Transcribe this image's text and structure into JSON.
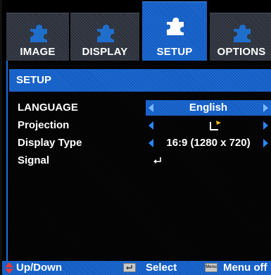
{
  "tabs": [
    {
      "label": "IMAGE",
      "active": false
    },
    {
      "label": "DISPLAY",
      "active": false
    },
    {
      "label": "SETUP",
      "active": true
    },
    {
      "label": "OPTIONS",
      "active": false
    }
  ],
  "panel": {
    "title": "SETUP",
    "rows": [
      {
        "name": "LANGUAGE",
        "value": "English",
        "selected": true
      },
      {
        "name": "Projection",
        "value": "",
        "icon": "projection-front-icon"
      },
      {
        "name": "Display Type",
        "value": "16:9 (1280 x 720)"
      },
      {
        "name": "Signal",
        "value": "",
        "icon": "enter-arrow-icon"
      }
    ]
  },
  "status_bar": {
    "updown_label": "Up/Down",
    "select_label": "Select",
    "menu_label": "Menu off",
    "menu_key_text": "Menu"
  },
  "colors": {
    "accent": "#1d6fd8",
    "arrow": "#2a86ff",
    "updown_icon": "#e8383a"
  }
}
